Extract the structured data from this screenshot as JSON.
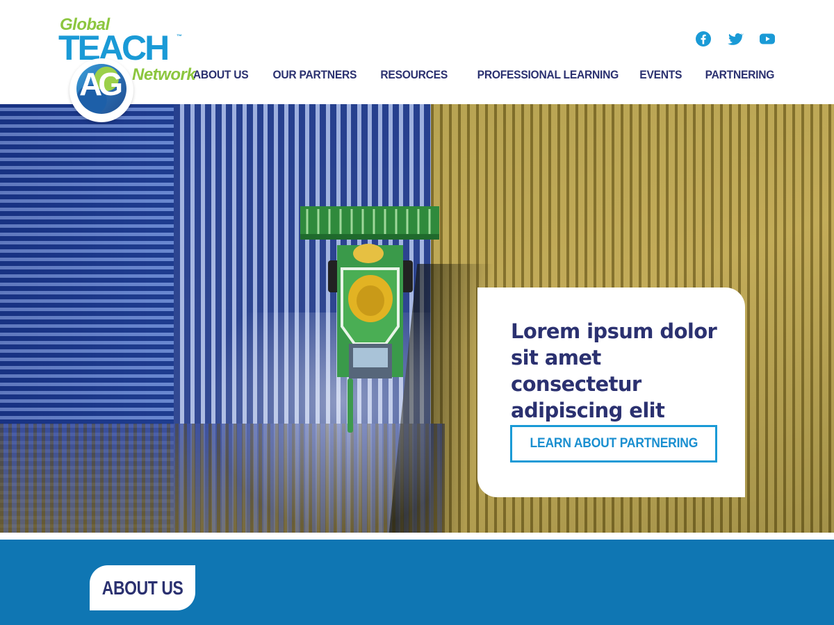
{
  "brand": {
    "word_top": "Global",
    "word_main": "TEACH",
    "trademark": "™",
    "word_bottom": "Network",
    "badge_letters": "AG"
  },
  "social": [
    {
      "name": "facebook-icon"
    },
    {
      "name": "twitter-icon"
    },
    {
      "name": "youtube-icon"
    }
  ],
  "nav": {
    "items": [
      {
        "label": "ABOUT US"
      },
      {
        "label": "OUR PARTNERS"
      },
      {
        "label": "RESOURCES"
      },
      {
        "label": "PROFESSIONAL LEARNING"
      },
      {
        "label": "EVENTS"
      },
      {
        "label": "PARTNERING"
      }
    ]
  },
  "hero": {
    "heading": "Lorem ipsum dolor sit amet consectetur adipiscing elit",
    "button_label": "LEARN ABOUT PARTNERING"
  },
  "about": {
    "tab_label": "ABOUT US"
  },
  "colors": {
    "navy": "#2b3170",
    "brand_blue": "#1a9ad6",
    "brand_green": "#8cc63f",
    "band_blue": "#0f76b3"
  }
}
